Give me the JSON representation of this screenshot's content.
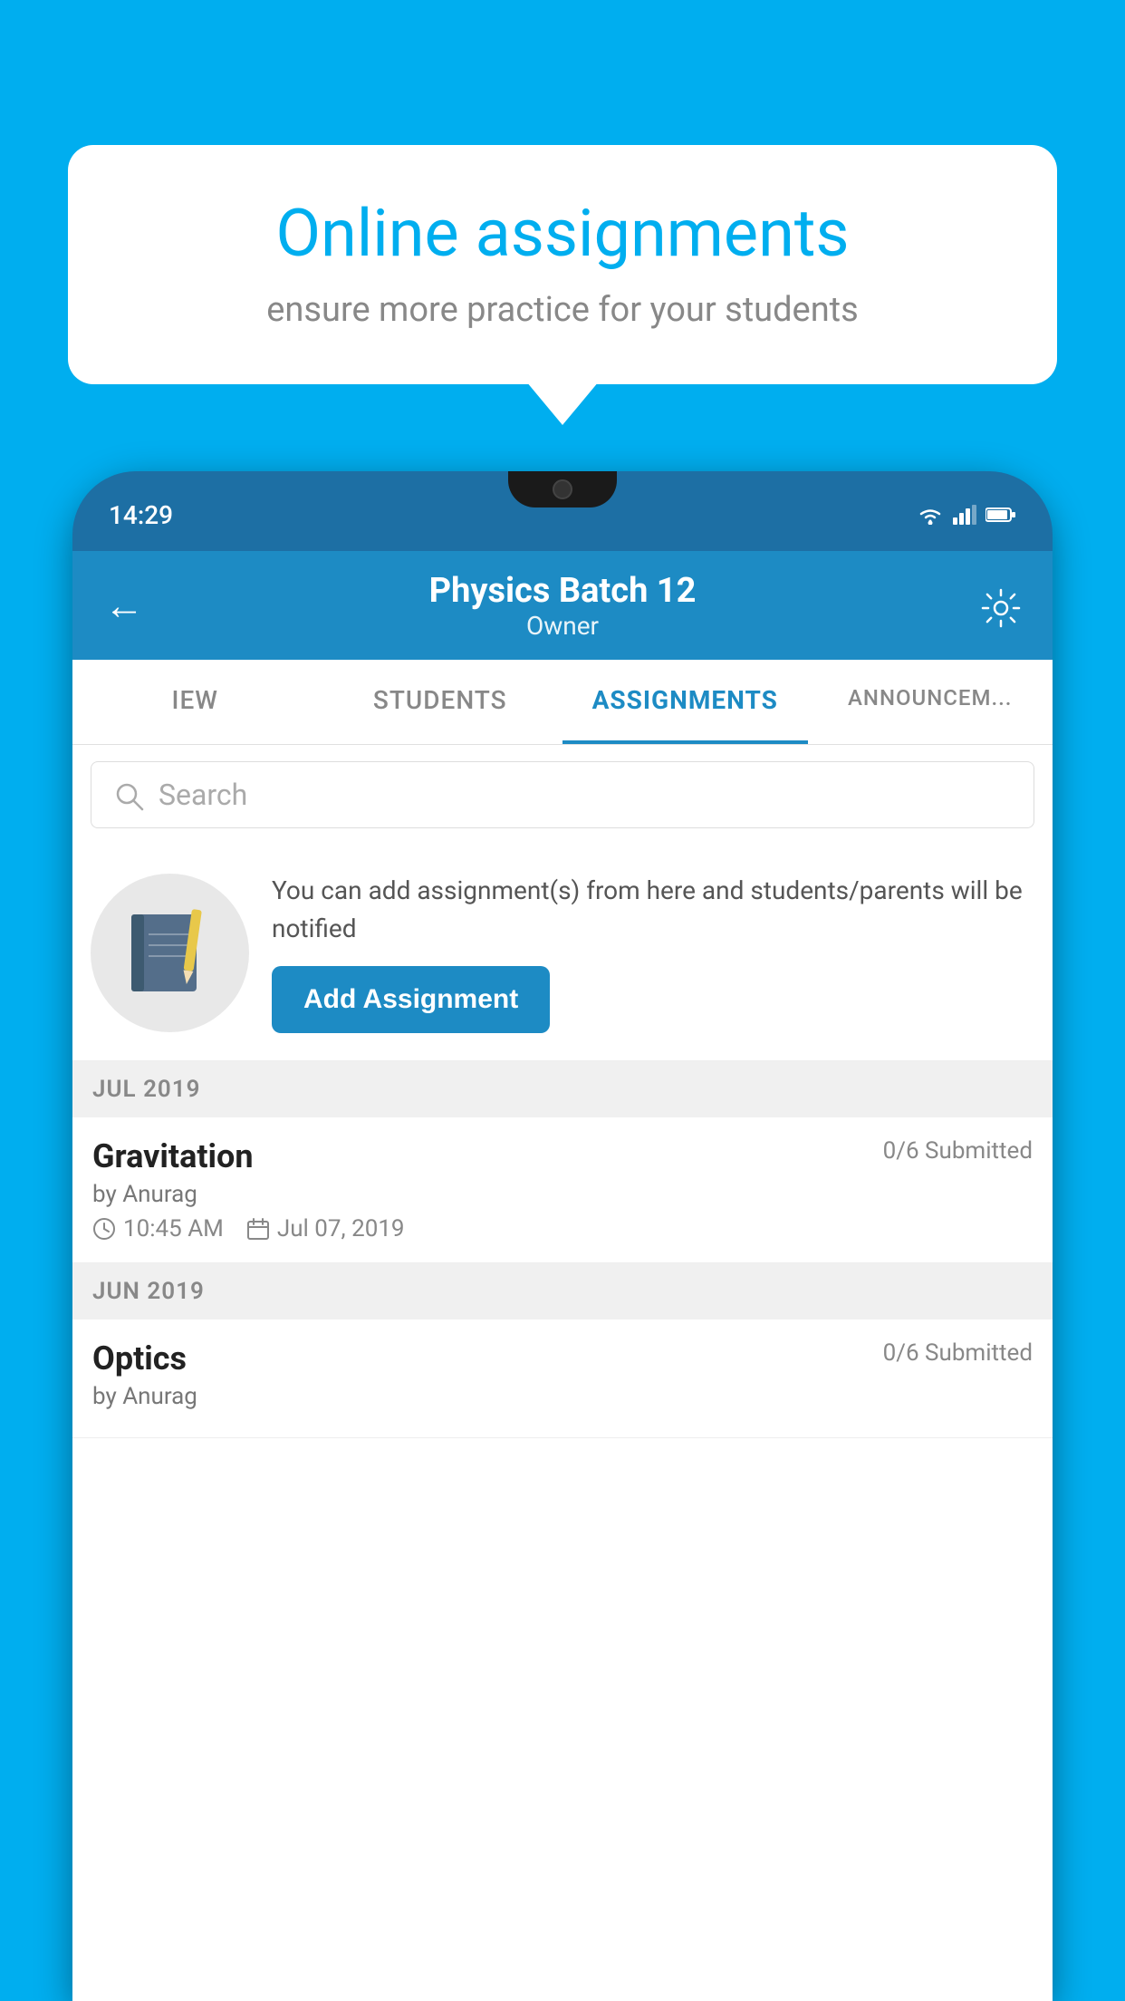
{
  "background_color": "#00AEEF",
  "speech_bubble": {
    "title": "Online assignments",
    "subtitle": "ensure more practice for your students"
  },
  "phone": {
    "status_bar": {
      "time": "14:29"
    },
    "header": {
      "title": "Physics Batch 12",
      "subtitle": "Owner",
      "back_label": "←",
      "settings_label": "⚙"
    },
    "tabs": [
      {
        "label": "IEW",
        "active": false
      },
      {
        "label": "STUDENTS",
        "active": false
      },
      {
        "label": "ASSIGNMENTS",
        "active": true
      },
      {
        "label": "ANNOUNCEM...",
        "active": false
      }
    ],
    "search": {
      "placeholder": "Search"
    },
    "add_assignment": {
      "description": "You can add assignment(s) from here and students/parents will be notified",
      "button_label": "Add Assignment"
    },
    "sections": [
      {
        "month": "JUL 2019",
        "assignments": [
          {
            "name": "Gravitation",
            "submitted": "0/6 Submitted",
            "by": "by Anurag",
            "time": "10:45 AM",
            "date": "Jul 07, 2019"
          }
        ]
      },
      {
        "month": "JUN 2019",
        "assignments": [
          {
            "name": "Optics",
            "submitted": "0/6 Submitted",
            "by": "by Anurag",
            "time": "",
            "date": ""
          }
        ]
      }
    ]
  }
}
